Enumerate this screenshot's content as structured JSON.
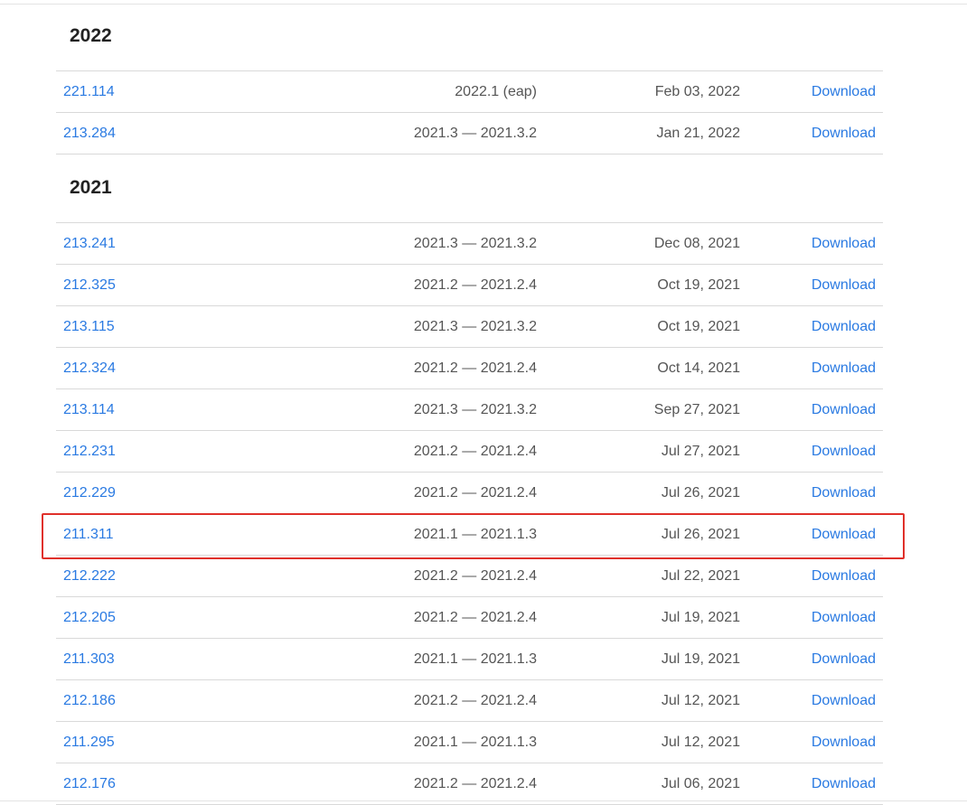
{
  "sections": [
    {
      "year": "2022",
      "rows": [
        {
          "build": "221.114",
          "range": "2022.1 (eap)",
          "date": "Feb 03, 2022",
          "action": "Download"
        },
        {
          "build": "213.284",
          "range": "2021.3 — 2021.3.2",
          "date": "Jan 21, 2022",
          "action": "Download"
        }
      ]
    },
    {
      "year": "2021",
      "rows": [
        {
          "build": "213.241",
          "range": "2021.3 — 2021.3.2",
          "date": "Dec 08, 2021",
          "action": "Download"
        },
        {
          "build": "212.325",
          "range": "2021.2 — 2021.2.4",
          "date": "Oct 19, 2021",
          "action": "Download"
        },
        {
          "build": "213.115",
          "range": "2021.3 — 2021.3.2",
          "date": "Oct 19, 2021",
          "action": "Download"
        },
        {
          "build": "212.324",
          "range": "2021.2 — 2021.2.4",
          "date": "Oct 14, 2021",
          "action": "Download"
        },
        {
          "build": "213.114",
          "range": "2021.3 — 2021.3.2",
          "date": "Sep 27, 2021",
          "action": "Download"
        },
        {
          "build": "212.231",
          "range": "2021.2 — 2021.2.4",
          "date": "Jul 27, 2021",
          "action": "Download"
        },
        {
          "build": "212.229",
          "range": "2021.2 — 2021.2.4",
          "date": "Jul 26, 2021",
          "action": "Download"
        },
        {
          "build": "211.311",
          "range": "2021.1 — 2021.1.3",
          "date": "Jul 26, 2021",
          "action": "Download"
        },
        {
          "build": "212.222",
          "range": "2021.2 — 2021.2.4",
          "date": "Jul 22, 2021",
          "action": "Download"
        },
        {
          "build": "212.205",
          "range": "2021.2 — 2021.2.4",
          "date": "Jul 19, 2021",
          "action": "Download"
        },
        {
          "build": "211.303",
          "range": "2021.1 — 2021.1.3",
          "date": "Jul 19, 2021",
          "action": "Download"
        },
        {
          "build": "212.186",
          "range": "2021.2 — 2021.2.4",
          "date": "Jul 12, 2021",
          "action": "Download"
        },
        {
          "build": "211.295",
          "range": "2021.1 — 2021.1.3",
          "date": "Jul 12, 2021",
          "action": "Download"
        },
        {
          "build": "212.176",
          "range": "2021.2 — 2021.2.4",
          "date": "Jul 06, 2021",
          "action": "Download"
        }
      ]
    }
  ],
  "highlight": {
    "section": 1,
    "row": 7,
    "color": "#e0302a"
  },
  "colors": {
    "link": "#2a7ae2",
    "text": "#555555",
    "heading": "#222222",
    "divider": "#d9d9d9"
  }
}
